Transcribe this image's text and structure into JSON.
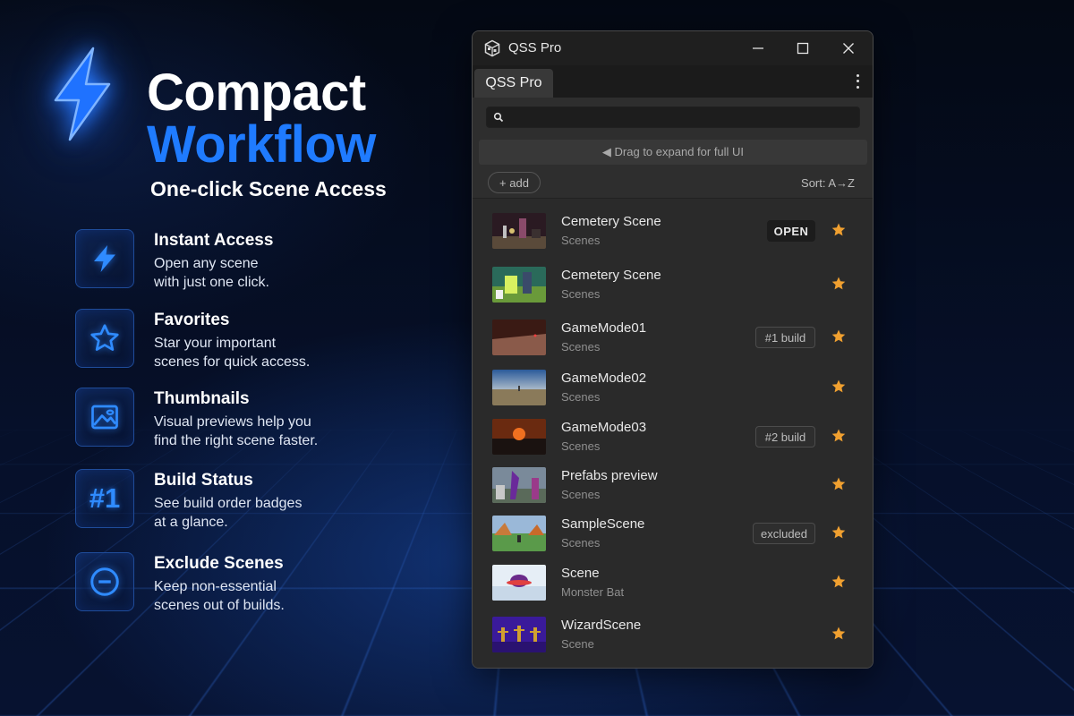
{
  "hero": {
    "title_line1": "Compact",
    "title_line2": "Workflow",
    "subtitle": "One-click Scene Access"
  },
  "features": [
    {
      "title": "Instant Access",
      "desc_line1": "Open any scene",
      "desc_line2": "with just one click.",
      "icon": "bolt-icon"
    },
    {
      "title": "Favorites",
      "desc_line1": "Star your important",
      "desc_line2": "scenes for quick access.",
      "icon": "star-icon"
    },
    {
      "title": "Thumbnails",
      "desc_line1": "Visual previews help you",
      "desc_line2": "find the right scene faster.",
      "icon": "image-icon"
    },
    {
      "title": "Build Status",
      "desc_line1": "See build order badges",
      "desc_line2": "at a glance.",
      "icon_text": "#1"
    },
    {
      "title": "Exclude Scenes",
      "desc_line1": "Keep non-essential",
      "desc_line2": "scenes out of builds.",
      "icon": "minus-circle-icon"
    }
  ],
  "window": {
    "title": "QSS Pro",
    "tab_label": "QSS Pro",
    "search_value": "",
    "drag_hint": "◀ Drag to expand for full UI",
    "add_label": "+ add",
    "sort_label": "Sort: A→Z",
    "accent_color": "#f0a030",
    "scenes": [
      {
        "name": "Cemetery Scene",
        "category": "Scenes",
        "badge": "OPEN",
        "starred": true
      },
      {
        "name": "Cemetery Scene",
        "category": "Scenes",
        "badge": "",
        "starred": true
      },
      {
        "name": "GameMode01",
        "category": "Scenes",
        "badge": "#1 build",
        "starred": true
      },
      {
        "name": "GameMode02",
        "category": "Scenes",
        "badge": "",
        "starred": true
      },
      {
        "name": "GameMode03",
        "category": "Scenes",
        "badge": "#2 build",
        "starred": true
      },
      {
        "name": "Prefabs preview",
        "category": "Scenes",
        "badge": "",
        "starred": true
      },
      {
        "name": "SampleScene",
        "category": "Scenes",
        "badge": "excluded",
        "starred": true
      },
      {
        "name": "Scene",
        "category": "Monster Bat",
        "badge": "",
        "starred": true
      },
      {
        "name": "WizardScene",
        "category": "Scene",
        "badge": "",
        "starred": true
      }
    ]
  }
}
